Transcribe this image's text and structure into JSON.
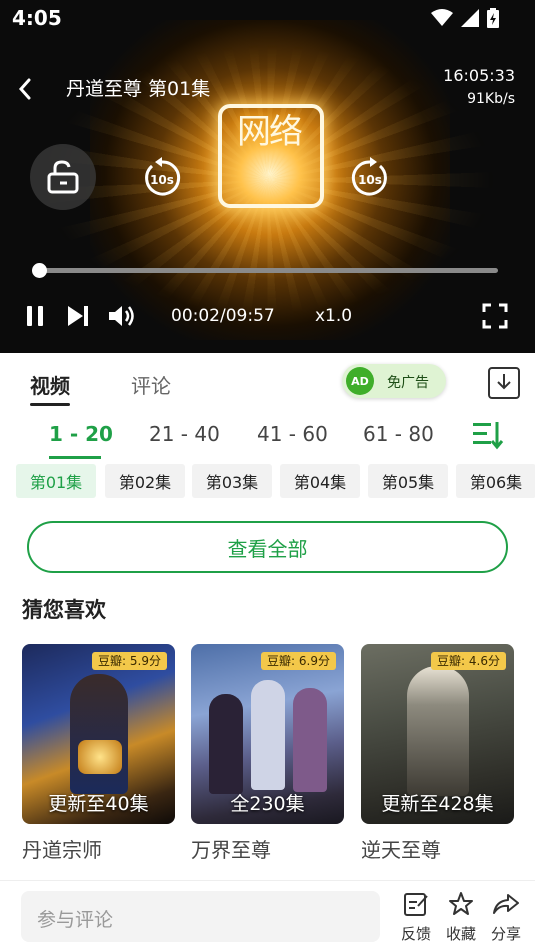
{
  "status_bar": {
    "time": "4:05"
  },
  "player": {
    "title": "丹道至尊 第01集",
    "clock": "16:05:33",
    "net_speed": "91Kb/s",
    "logo_text": "网络",
    "rewind_label": "10s",
    "forward_label": "10s",
    "progress_fraction": 0.0034,
    "current_time": "00:02",
    "time_separator": "/",
    "total_time": "09:57",
    "rate": "x1.0"
  },
  "tabs": {
    "video": "视频",
    "comment": "评论"
  },
  "ad_pill": {
    "badge": "AD",
    "label": "免广告"
  },
  "ranges": [
    {
      "label": "1 - 20",
      "active": true
    },
    {
      "label": "21 - 40",
      "active": false
    },
    {
      "label": "41 - 60",
      "active": false
    },
    {
      "label": "61 - 80",
      "active": false
    }
  ],
  "episodes": [
    "第01集",
    "第02集",
    "第03集",
    "第04集",
    "第05集",
    "第06集"
  ],
  "view_all": "查看全部",
  "recommend": {
    "title": "猜您喜欢",
    "items": [
      {
        "name": "丹道宗师",
        "rating": "豆瓣: 5.9分",
        "update": "更新至40集"
      },
      {
        "name": "万界至尊",
        "rating": "豆瓣: 6.9分",
        "update": "全230集"
      },
      {
        "name": "逆天至尊",
        "rating": "豆瓣: 4.6分",
        "update": "更新至428集"
      }
    ]
  },
  "bottom_bar": {
    "comment_placeholder": "参与评论",
    "feedback": "反馈",
    "favorite": "收藏",
    "share": "分享"
  },
  "colors": {
    "accent": "#1fa047",
    "rating_badge": "#f3c84a"
  }
}
